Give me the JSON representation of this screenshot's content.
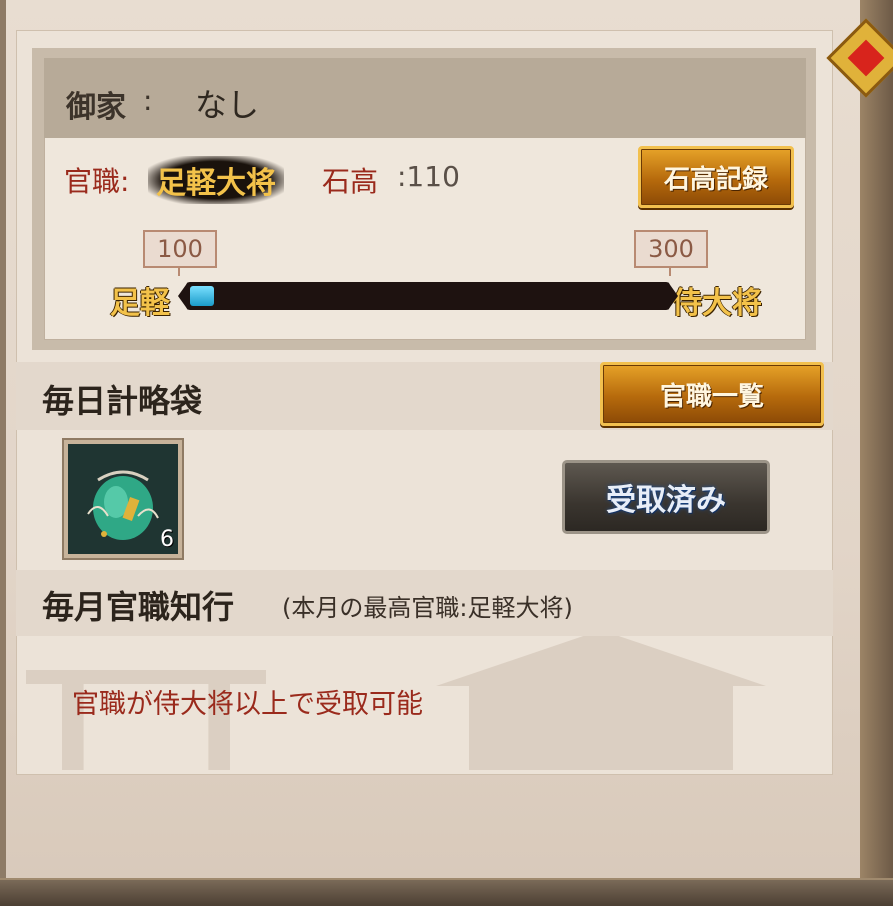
{
  "house": {
    "label": "御家",
    "colon": ":",
    "value": "なし"
  },
  "rank": {
    "label": "官職:",
    "value": "足軽大将"
  },
  "koku": {
    "label": "石高",
    "value": ":110"
  },
  "buttons": {
    "koku_record": "石高記録",
    "rank_list": "官職一覧",
    "received": "受取済み"
  },
  "progress": {
    "start_label": "足軽",
    "end_label": "侍大将",
    "start_value": "100",
    "end_value": "300",
    "current": 110,
    "min": 100,
    "max": 300
  },
  "daily": {
    "title": "毎日計略袋",
    "item_icon": "green-pouch-icon",
    "item_count": "6"
  },
  "monthly": {
    "title": "毎月官職知行",
    "subtitle": "(本月の最高官職:足軽大将)",
    "notice": "官職が侍大将以上で受取可能"
  },
  "colors": {
    "accent_red": "#9a2a1c",
    "gold_text": "#f3c24a",
    "progress_fill": "#1b9bc9"
  }
}
